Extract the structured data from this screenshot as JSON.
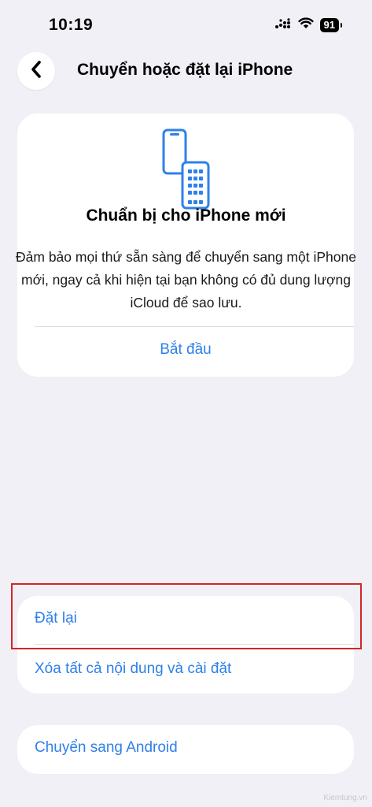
{
  "status_bar": {
    "time": "10:19",
    "battery": "91"
  },
  "nav": {
    "title": "Chuyển hoặc đặt lại iPhone"
  },
  "prepare_card": {
    "heading": "Chuẩn bị cho iPhone mới",
    "description": "Đảm bảo mọi thứ sẵn sàng để chuyển sang một iPhone mới, ngay cả khi hiện tại bạn không có đủ dung lượng iCloud để sao lưu.",
    "action_label": "Bắt đầu",
    "icon": "two-phones-icon"
  },
  "reset_group": {
    "items": [
      {
        "label": "Đặt lại"
      },
      {
        "label": "Xóa tất cả nội dung và cài đặt"
      }
    ]
  },
  "android_group": {
    "label": "Chuyển sang Android"
  },
  "watermark": "Kiemtung.vn",
  "colors": {
    "accent": "#2f80e8",
    "background": "#f0f0f6",
    "highlight": "#d42626"
  }
}
